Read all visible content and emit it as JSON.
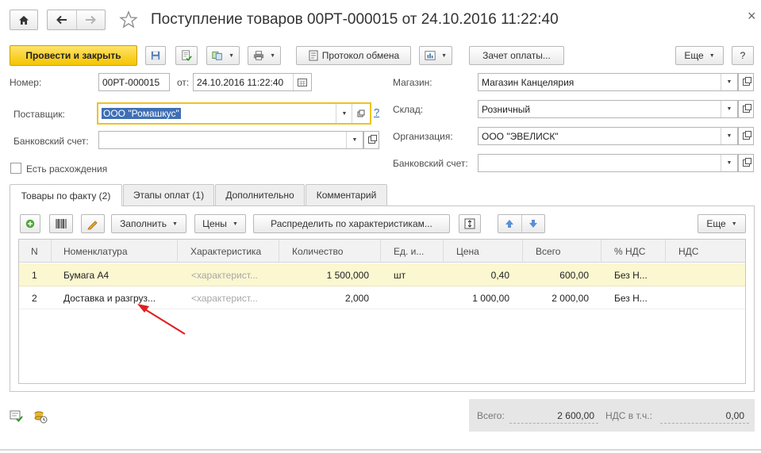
{
  "window": {
    "title": "Поступление товаров 00РТ-000015 от 24.10.2016 11:22:40",
    "close_glyph": "×"
  },
  "toolbar": {
    "post_and_close": "Провести и закрыть",
    "exchange_protocol": "Протокол обмена",
    "payment_offset": "Зачет оплаты...",
    "more": "Еще",
    "help": "?"
  },
  "form": {
    "number_label": "Номер:",
    "number_value": "00РТ-000015",
    "date_label": "от:",
    "date_value": "24.10.2016 11:22:40",
    "supplier_label": "Поставщик:",
    "supplier_value": "ООО \"Ромашкус\"",
    "supplier_help": "?",
    "bank_account_label": "Банковский счет:",
    "bank_account_value": "",
    "discrepancy_label": "Есть расхождения",
    "discrepancy_checked": false,
    "store_label": "Магазин:",
    "store_value": "Магазин Канцелярия",
    "warehouse_label": "Склад:",
    "warehouse_value": "Розничный",
    "organization_label": "Организация:",
    "organization_value": "ООО \"ЭВЕЛИСК\"",
    "org_bank_account_label": "Банковский счет:",
    "org_bank_account_value": ""
  },
  "tabs": [
    {
      "label": "Товары по факту (2)",
      "active": true
    },
    {
      "label": "Этапы оплат (1)",
      "active": false
    },
    {
      "label": "Дополнительно",
      "active": false
    },
    {
      "label": "Комментарий",
      "active": false
    }
  ],
  "table_toolbar": {
    "fill": "Заполнить",
    "prices": "Цены",
    "distribute": "Распределить по характеристикам...",
    "more": "Еще"
  },
  "table": {
    "columns": [
      "N",
      "Номенклатура",
      "Характеристика",
      "Количество",
      "Ед. и...",
      "Цена",
      "Всего",
      "% НДС",
      "НДС"
    ],
    "rows": [
      {
        "n": "1",
        "item": "Бумага А4",
        "characteristic": "<характерист...",
        "qty": "1 500,000",
        "unit": "шт",
        "price": "0,40",
        "total": "600,00",
        "vat_rate": "Без Н...",
        "vat": "",
        "selected": true
      },
      {
        "n": "2",
        "item": "Доставка и разгруз...",
        "characteristic": "<характерист...",
        "qty": "2,000",
        "unit": "",
        "price": "1 000,00",
        "total": "2 000,00",
        "vat_rate": "Без Н...",
        "vat": "",
        "selected": false
      }
    ]
  },
  "totals": {
    "total_label": "Всего:",
    "total_value": "2 600,00",
    "vat_label": "НДС в т.ч.:",
    "vat_value": "0,00"
  },
  "colors": {
    "primary_button": "#f5c400",
    "selected_row": "#fbf7d0",
    "annotation_arrow": "#e02020",
    "totals_panel": "#e6e6e6"
  }
}
